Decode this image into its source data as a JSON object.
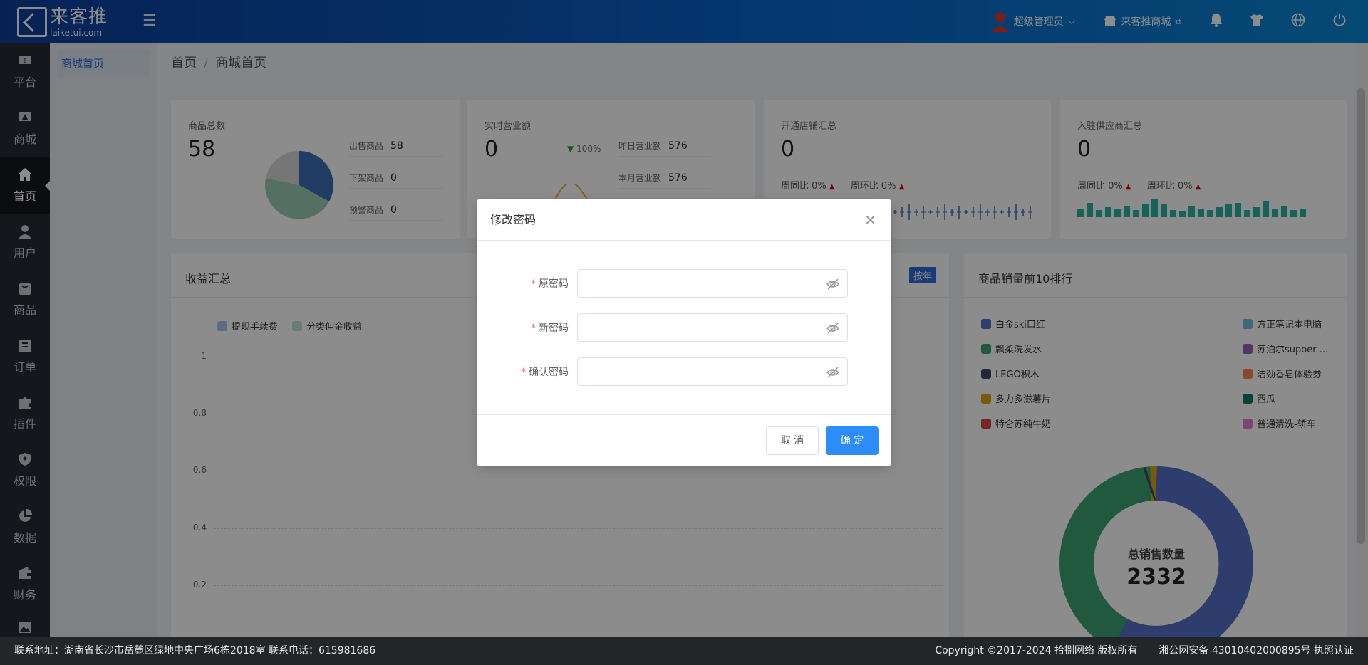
{
  "brand": {
    "name_cn": "来客推",
    "domain": "laiketui.com"
  },
  "topbar": {
    "admin_label": "超级管理员",
    "store_label": "来客推商城"
  },
  "sidebar": {
    "items": [
      {
        "label": "平台",
        "icon": "platform-icon"
      },
      {
        "label": "商城",
        "icon": "store-icon"
      },
      {
        "label": "首页",
        "icon": "home-icon"
      },
      {
        "label": "用户",
        "icon": "user-icon"
      },
      {
        "label": "商品",
        "icon": "goods-icon"
      },
      {
        "label": "订单",
        "icon": "order-icon"
      },
      {
        "label": "插件",
        "icon": "plugin-icon"
      },
      {
        "label": "权限",
        "icon": "permission-icon"
      },
      {
        "label": "数据",
        "icon": "data-icon"
      },
      {
        "label": "财务",
        "icon": "finance-icon"
      }
    ]
  },
  "subsidebar": {
    "active": "商城首页"
  },
  "breadcrumb": {
    "home": "首页",
    "separator": "/",
    "current": "商城首页"
  },
  "cards": {
    "goods": {
      "title": "商品总数",
      "value": "58",
      "rows": [
        {
          "label": "出售商品",
          "value": "58"
        },
        {
          "label": "下架商品",
          "value": "0"
        },
        {
          "label": "预警商品",
          "value": "0"
        }
      ]
    },
    "revenue": {
      "title": "实时营业额",
      "value": "0",
      "change": "100%",
      "rows": [
        {
          "label": "昨日营业额",
          "value": "576"
        },
        {
          "label": "本月营业额",
          "value": "576"
        }
      ]
    },
    "shops": {
      "title": "开通店铺汇总",
      "value": "0",
      "wow_label": "周同比",
      "wow": "0%",
      "mom_label": "周环比",
      "mom": "0%"
    },
    "suppliers": {
      "title": "入驻供应商汇总",
      "value": "0",
      "wow_label": "周同比",
      "wow": "0%",
      "mom_label": "周环比",
      "mom": "0%"
    }
  },
  "income": {
    "title": "收益汇总",
    "period_button": "按年",
    "legend": [
      "提现手续费",
      "分类佣金收益"
    ],
    "yticks": [
      "1",
      "0.8",
      "0.6",
      "0.4",
      "0.2"
    ]
  },
  "ranking": {
    "title": "商品销量前10排行",
    "items": [
      {
        "name": "白金ski口红",
        "color": "#5470c6"
      },
      {
        "name": "方正笔记本电脑",
        "color": "#73c0de"
      },
      {
        "name": "飘柔洗发水",
        "color": "#3ba272"
      },
      {
        "name": "苏泊尔supoer ...",
        "color": "#9a60b4"
      },
      {
        "name": "LEGO积木",
        "color": "#3b4a6b"
      },
      {
        "name": "洁劲香皂体验券",
        "color": "#fc8452"
      },
      {
        "name": "多力多滋薯片",
        "color": "#d4a414"
      },
      {
        "name": "西瓜",
        "color": "#14776a"
      },
      {
        "name": "特仑苏纯牛奶",
        "color": "#d64541"
      },
      {
        "name": "普通清洗-轿车",
        "color": "#ea7ccc"
      }
    ],
    "center_label": "总销售数量",
    "center_value": "2332"
  },
  "dialog": {
    "title": "修改密码",
    "fields": [
      {
        "label": "原密码",
        "value": ""
      },
      {
        "label": "新密码",
        "value": ""
      },
      {
        "label": "确认密码",
        "value": ""
      }
    ],
    "cancel": "取 消",
    "confirm": "确 定"
  },
  "footer": {
    "left": "联系地址：湖南省长沙市岳麓区绿地中央广场6栋2018室 联系电话：615981686",
    "right": "Copyright ©2017-2024 拾捌网络 版权所有",
    "icp": "湘公网安备 43010402000895号 执照认证"
  },
  "colors": {
    "topbar": "#0a63c9",
    "sidebar": "#252a33",
    "primary": "#2c8cf8",
    "required": "#f56c6c"
  }
}
